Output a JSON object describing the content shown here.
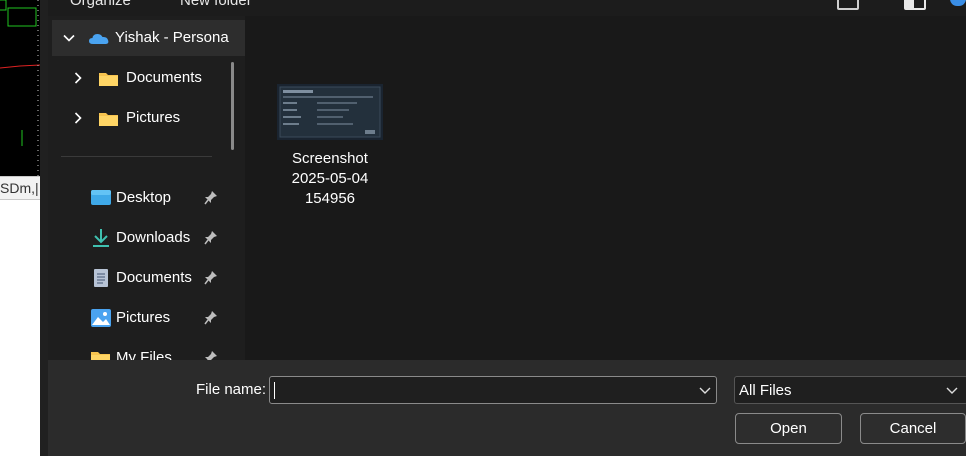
{
  "background_app": {
    "tab_text": "SDm,|"
  },
  "toolbar": {
    "organize_label": "Organize",
    "new_folder_label": "New folder"
  },
  "nav": {
    "root": {
      "label": "Yishak - Persona"
    },
    "children": [
      {
        "label": "Documents",
        "icon": "folder-icon"
      },
      {
        "label": "Pictures",
        "icon": "folder-icon"
      }
    ],
    "quick_access": [
      {
        "label": "Desktop",
        "icon": "desktop-icon"
      },
      {
        "label": "Downloads",
        "icon": "downloads-icon"
      },
      {
        "label": "Documents",
        "icon": "documents-icon"
      },
      {
        "label": "Pictures",
        "icon": "pictures-icon"
      },
      {
        "label": "My Files",
        "icon": "folder-icon"
      }
    ]
  },
  "content": {
    "file": {
      "line1": "Screenshot",
      "line2": "2025-05-04",
      "line3": "154956"
    }
  },
  "bottom": {
    "file_name_label": "File name:",
    "file_name_value": "",
    "file_type_value": "All Files",
    "open_label": "Open",
    "cancel_label": "Cancel"
  },
  "colors": {
    "folder": "#f8c44f",
    "onedrive": "#4aa3f0",
    "downloads": "#3fc1b0",
    "accent": "#3a8ee6"
  }
}
